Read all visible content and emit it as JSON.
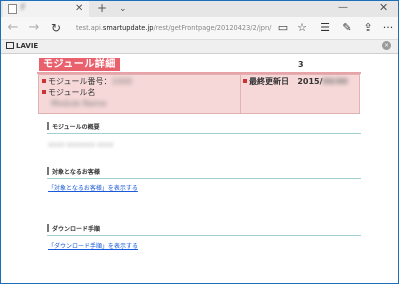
{
  "browser": {
    "tab": {
      "title": "F",
      "close_glyph": "✕"
    },
    "new_tab_glyph": "+",
    "tab_list_glyph": "⌄",
    "window": {
      "minimize_glyph": "—",
      "close_glyph": "✕"
    },
    "nav": {
      "back_icon": "←",
      "forward_icon": "→",
      "refresh_icon": "↻"
    },
    "address": {
      "prefix": "test.api.",
      "host": "smartupdate.jp",
      "path": "/rest/getFrontpage/20120423/2/jpn/?id=10"
    },
    "toolbar": {
      "reading_view_icon": "▭",
      "favorite_icon": "☆",
      "hub_icon": "☰",
      "web_note_icon": "✎",
      "share_icon": "⇪",
      "more_icon": "···"
    }
  },
  "brandbar": {
    "logo_text": "LAVIE",
    "close_glyph": "×"
  },
  "page": {
    "title": "モジュール詳細",
    "title_number": "3",
    "info": {
      "module_number_label": "モジュール番号：",
      "module_number_value": "1000",
      "module_name_label": "モジュール名",
      "module_name_value": "Module Name",
      "last_updated_label": "最終更新日",
      "last_updated_value": "2015/",
      "last_updated_hidden": "00/00"
    },
    "sections": [
      {
        "heading": "モジュールの概要",
        "body": "XXXX XXXXXXX XXXX"
      },
      {
        "heading": "対象となるお客様",
        "link": "「対象となるお客様」を表示する"
      },
      {
        "heading": "ダウンロード手順",
        "link": "「ダウンロード手順」を表示する"
      }
    ]
  },
  "colors": {
    "title_bg": "#e9616d",
    "info_bg": "#f6d8d8",
    "link": "#1a5ad8",
    "section_rule": "#9fd0d4"
  }
}
